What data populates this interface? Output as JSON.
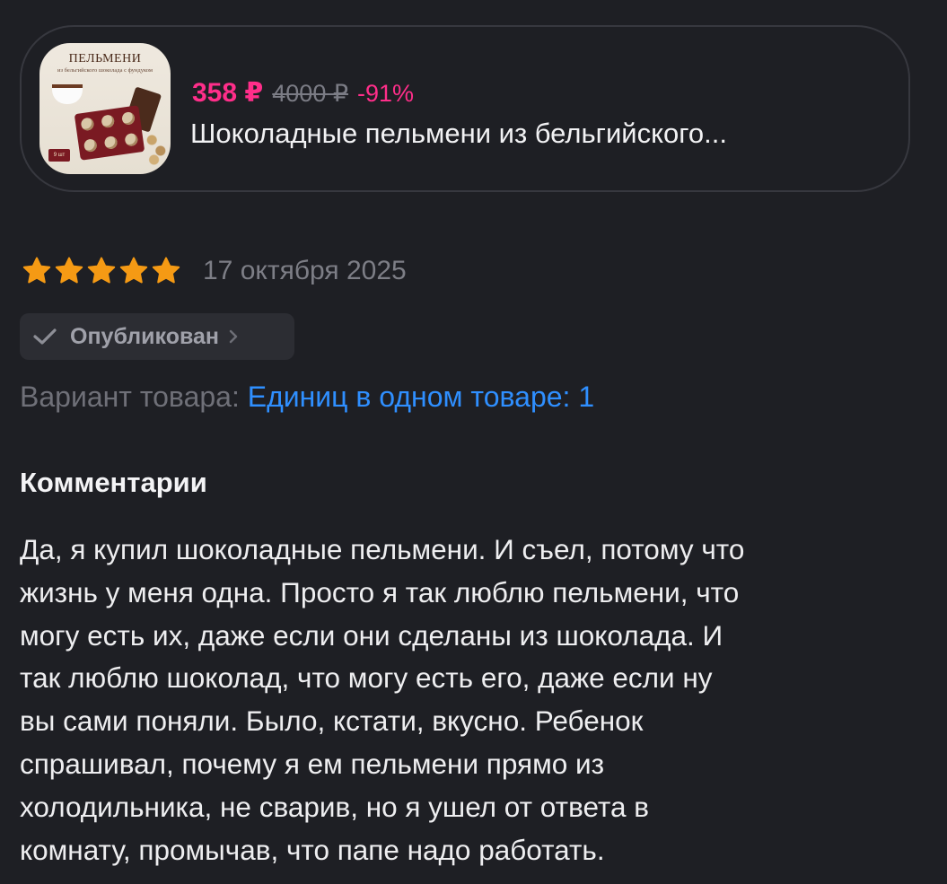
{
  "product": {
    "thumb_title": "ПЕЛЬМЕНИ",
    "thumb_subtitle": "из бельгийского шоколада с фундуком",
    "thumb_tag": "9 шт",
    "price_current": "358 ₽",
    "price_old": "4000 ₽",
    "price_discount": "-91%",
    "title": "Шоколадные пельмени из бельгийского..."
  },
  "review": {
    "rating": 5,
    "rating_max": 5,
    "date": "17 октября 2025",
    "status_label": "Опубликован",
    "variant_label": "Вариант товара:",
    "variant_value": "Единиц в одном товаре: 1",
    "comments_heading": "Комментарии",
    "comment_text": "Да, я купил шоколадные пельмени. И съел, потому что\nжизнь у меня одна.  Просто я так люблю пельмени, что\nмогу есть их, даже если они сделаны из шоколада. И\nтак люблю шоколад, что могу есть его, даже если ну\nвы сами поняли. Было, кстати, вкусно. Ребенок\nспрашивал, почему я ем пельмени прямо из\nхолодильника, не сварив, но я ушел от ответа в\nкомнату, промычав, что папе надо работать."
  },
  "colors": {
    "background": "#1e1f24",
    "price_accent": "#ff2e8a",
    "star": "#f59a14",
    "link": "#2f8fff",
    "muted": "#7d7e86"
  },
  "icons": {
    "star": "star-icon",
    "check": "check-icon",
    "chevron": "chevron-right-icon"
  }
}
